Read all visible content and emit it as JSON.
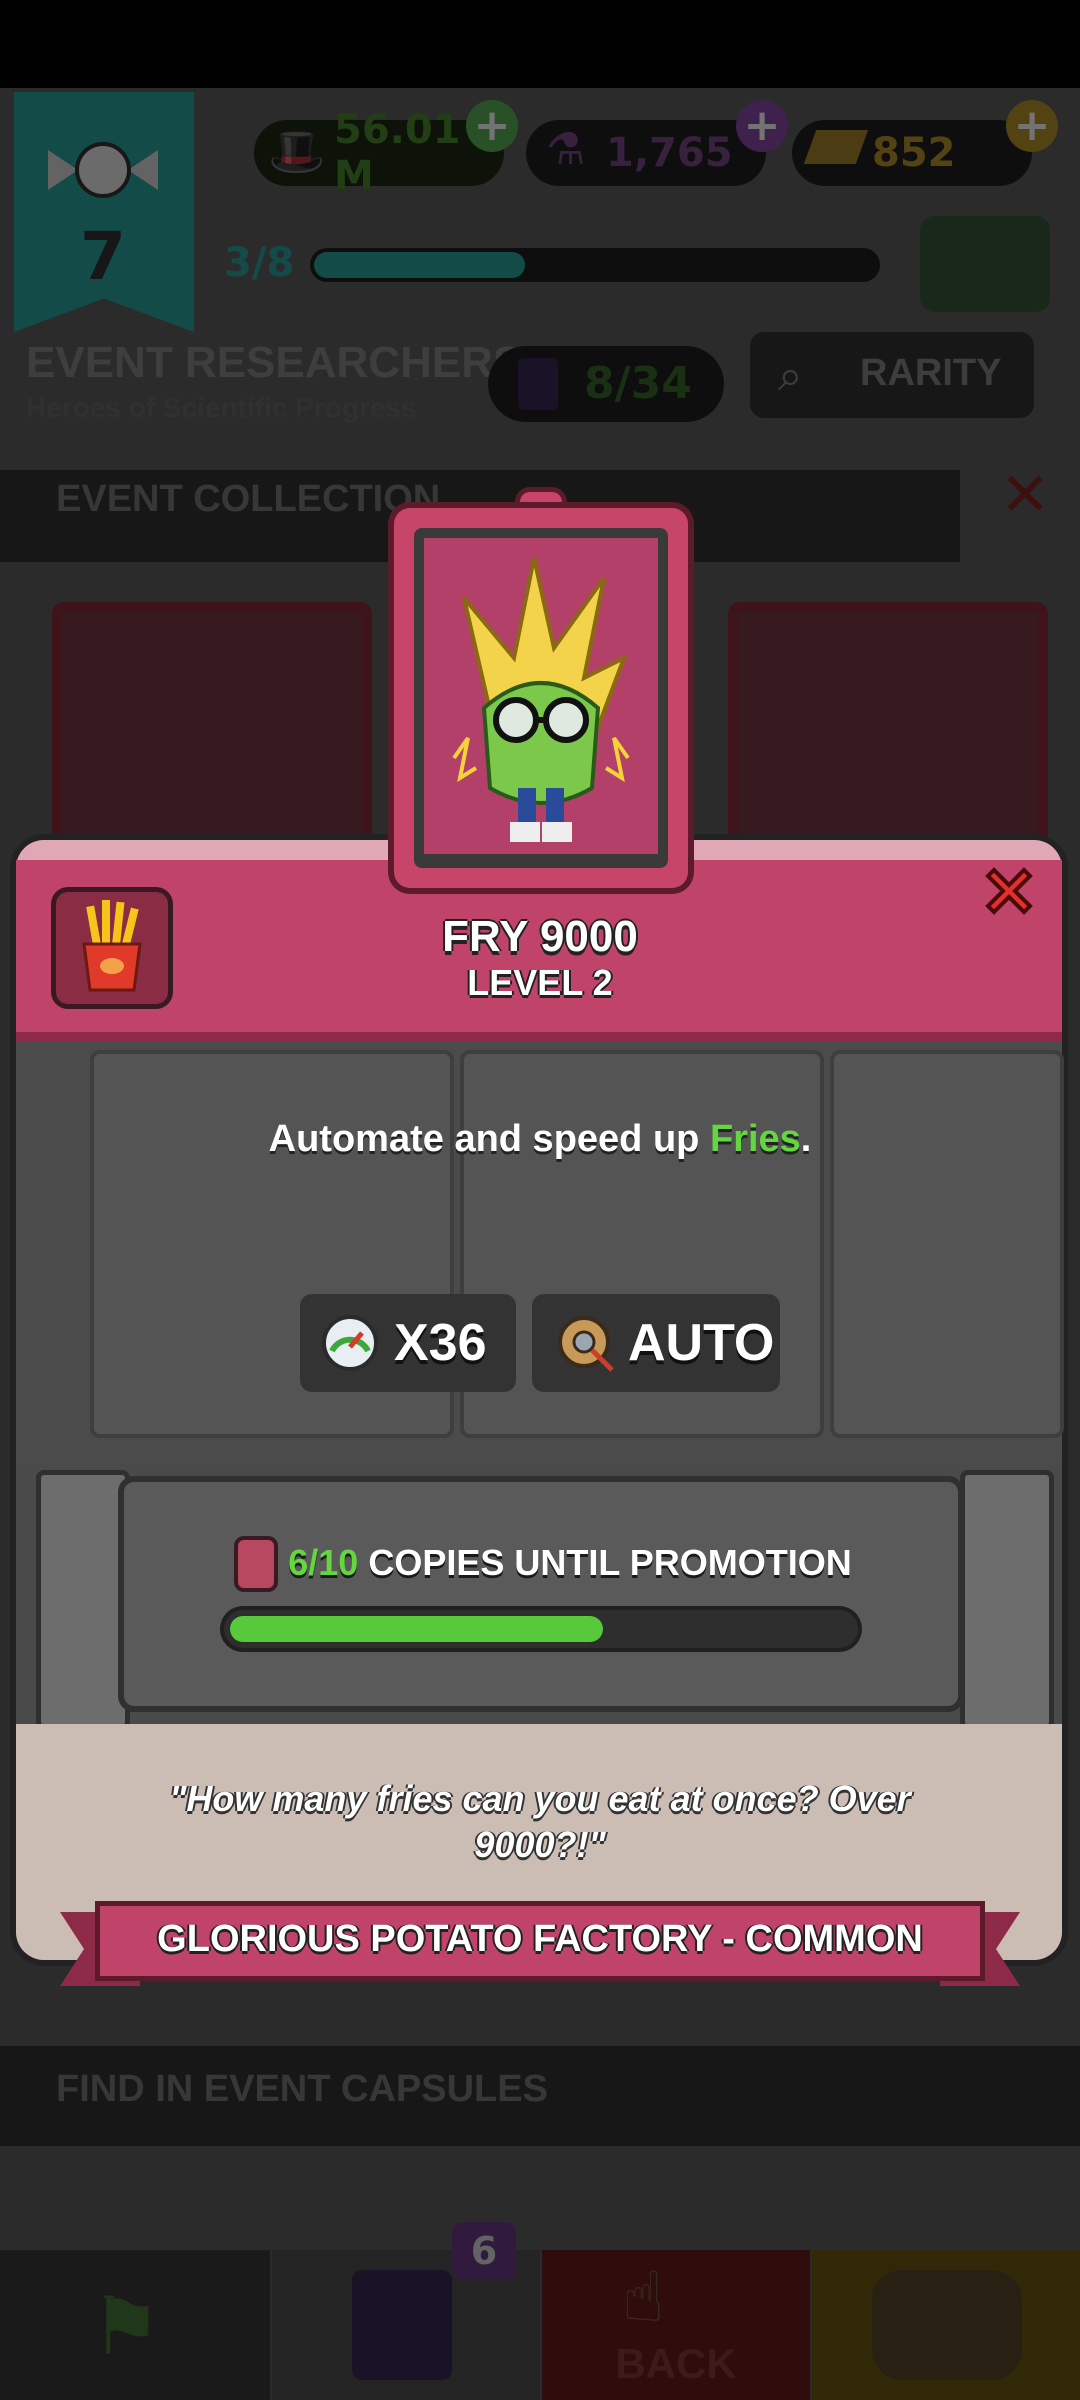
{
  "hud": {
    "level": "7",
    "xp_progress": "3/8",
    "xp_fraction": 0.375,
    "cash": "56.01 M",
    "potions": "1,765",
    "gold": "852"
  },
  "event": {
    "title": "EVENT RESEARCHERS",
    "subtitle": "Heroes of Scientific Progress",
    "collected": "8/34",
    "filter_label": "RARITY",
    "collection_label": "EVENT COLLECTION",
    "find_label": "FIND IN EVENT CAPSULES"
  },
  "nav": {
    "cards_badge": "6",
    "back_label": "BACK"
  },
  "card": {
    "name": "FRY 9000",
    "level": "LEVEL 2",
    "description_prefix": "Automate and speed up ",
    "description_highlight": "Fries",
    "description_suffix": ".",
    "speed_multiplier": "X36",
    "automation": "AUTO",
    "copies_count": "6/10",
    "copies_label": "COPIES UNTIL PROMOTION",
    "copies_fraction": 0.6,
    "quote": "\"How many fries can you eat at once? Over 9000?!\"",
    "footer": "GLORIOUS POTATO FACTORY - COMMON"
  },
  "colors": {
    "accent_pink": "#c0436a",
    "progress_green": "#58c93a",
    "highlight_green": "#63d640"
  }
}
